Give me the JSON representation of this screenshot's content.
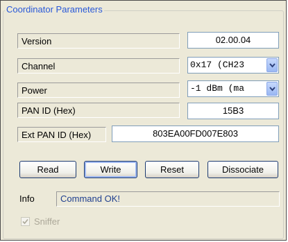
{
  "group": {
    "title": "Coordinator Parameters"
  },
  "fields": {
    "version": {
      "label": "Version",
      "value": "02.00.04"
    },
    "channel": {
      "label": "Channel",
      "value": "0x17 (CH23"
    },
    "power": {
      "label": "Power",
      "value": "-1 dBm (ma"
    },
    "pan_id": {
      "label": "PAN ID (Hex)",
      "value": "15B3"
    },
    "ext_pan_id": {
      "label": "Ext PAN ID (Hex)",
      "value": "803EA00FD007E803"
    }
  },
  "buttons": {
    "read": "Read",
    "write": "Write",
    "reset": "Reset",
    "dissociate": "Dissociate"
  },
  "info": {
    "label": "Info",
    "value": "Command OK!"
  },
  "sniffer": {
    "label": "Sniffer",
    "checked": true,
    "enabled": false
  },
  "colors": {
    "group_title": "#2858d8",
    "info_text": "#1f3f8f",
    "panel_bg": "#ece9d8",
    "disabled_text": "#aca899"
  }
}
